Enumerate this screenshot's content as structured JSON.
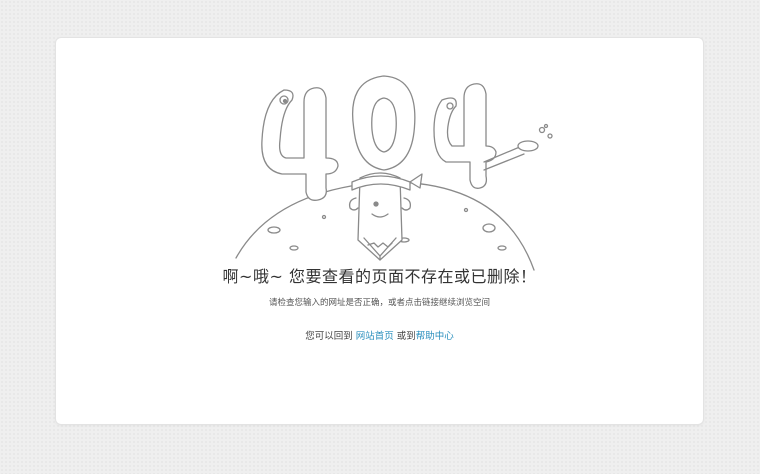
{
  "error": {
    "title": "啊~哦~ 您要查看的页面不存在或已删除！",
    "subtitle": "请检查您输入的网址是否正确，或者点击链接继续浏览空间",
    "nav_prefix": "您可以回到",
    "home_link": "网站首页",
    "or_text": "或到",
    "help_link": "帮助中心"
  },
  "illustration": {
    "icon": "404-pencil-planet-illustration",
    "stroke_color": "#8a8a8a",
    "fill_color": "#ffffff"
  },
  "colors": {
    "background": "#efefef",
    "card": "#ffffff",
    "link": "#2a8fbd",
    "text": "#333333"
  }
}
